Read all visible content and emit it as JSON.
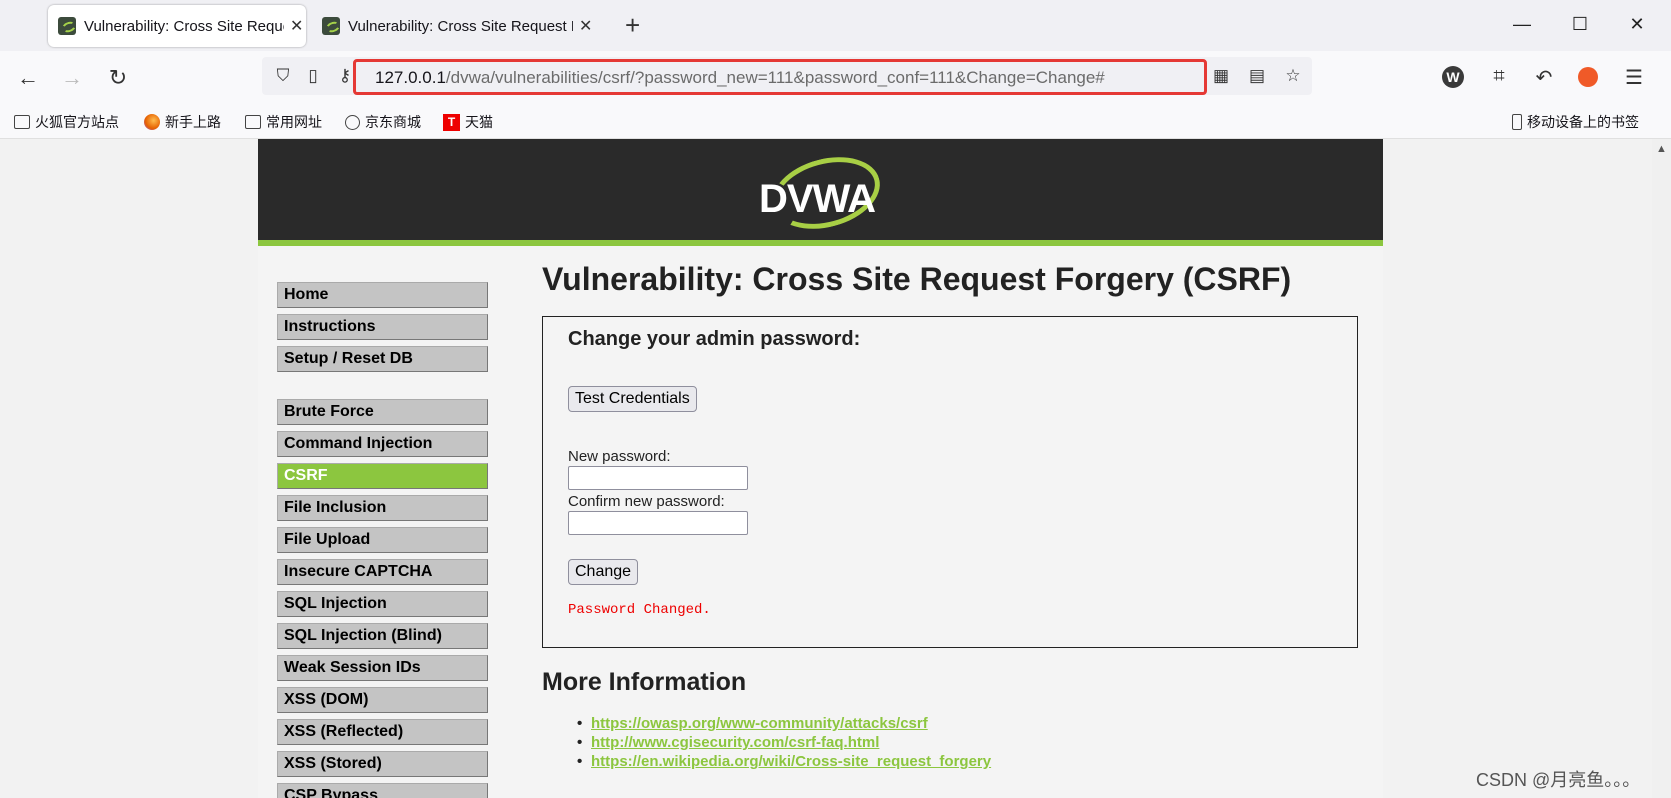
{
  "browser": {
    "tabs": [
      {
        "title": "Vulnerability: Cross Site Request Forgery (CSRF) :: Damn Vulnerable Web Application (DVWA)",
        "active": true
      },
      {
        "title": "Vulnerability: Cross Site Request Forgery (CSRF) :: Damn Vulnerable Web Application (DVWA)",
        "active": false
      }
    ],
    "new_tab": "+",
    "window_controls": {
      "minimize": "—",
      "maximize": "☐",
      "close": "✕"
    },
    "url": {
      "host": "127.0.0.1",
      "path": "/dvwa/vulnerabilities/csrf/?password_new=111&password_conf=111&Change=Change#"
    },
    "bookmarks": [
      {
        "label": "火狐官方站点",
        "icon": "folder-icon"
      },
      {
        "label": "新手上路",
        "icon": "firefox-icon"
      },
      {
        "label": "常用网址",
        "icon": "folder-icon"
      },
      {
        "label": "京东商城",
        "icon": "globe-icon"
      },
      {
        "label": "天猫",
        "icon": "tmall-icon"
      }
    ],
    "mobile_bookmarks": "移动设备上的书签",
    "tmall_letter": "T",
    "ext_w_letter": "W"
  },
  "page": {
    "menu": [
      {
        "label": "Home",
        "selected": false
      },
      {
        "label": "Instructions",
        "selected": false
      },
      {
        "label": "Setup / Reset DB",
        "selected": false
      },
      {
        "label": "Brute Force",
        "selected": false
      },
      {
        "label": "Command Injection",
        "selected": false
      },
      {
        "label": "CSRF",
        "selected": true
      },
      {
        "label": "File Inclusion",
        "selected": false
      },
      {
        "label": "File Upload",
        "selected": false
      },
      {
        "label": "Insecure CAPTCHA",
        "selected": false
      },
      {
        "label": "SQL Injection",
        "selected": false
      },
      {
        "label": "SQL Injection (Blind)",
        "selected": false
      },
      {
        "label": "Weak Session IDs",
        "selected": false
      },
      {
        "label": "XSS (DOM)",
        "selected": false
      },
      {
        "label": "XSS (Reflected)",
        "selected": false
      },
      {
        "label": "XSS (Stored)",
        "selected": false
      },
      {
        "label": "CSP Bypass",
        "selected": false
      }
    ],
    "logo_text": "DVWA",
    "title": "Vulnerability: Cross Site Request Forgery (CSRF)",
    "form": {
      "heading": "Change your admin password:",
      "test_button": "Test Credentials",
      "new_password_label": "New password:",
      "new_password_value": "",
      "confirm_password_label": "Confirm new password:",
      "confirm_password_value": "",
      "change_button": "Change",
      "message": "Password Changed."
    },
    "more_info_title": "More Information",
    "links": [
      "https://owasp.org/www-community/attacks/csrf",
      "http://www.cgisecurity.com/csrf-faq.html",
      "https://en.wikipedia.org/wiki/Cross-site_request_forgery"
    ]
  },
  "watermark": "CSDN @月亮鱼。。。",
  "colors": {
    "accent": "#8cc63f",
    "header": "#2a2a2a",
    "error": "#e00000",
    "url_highlight": "#e53935"
  }
}
